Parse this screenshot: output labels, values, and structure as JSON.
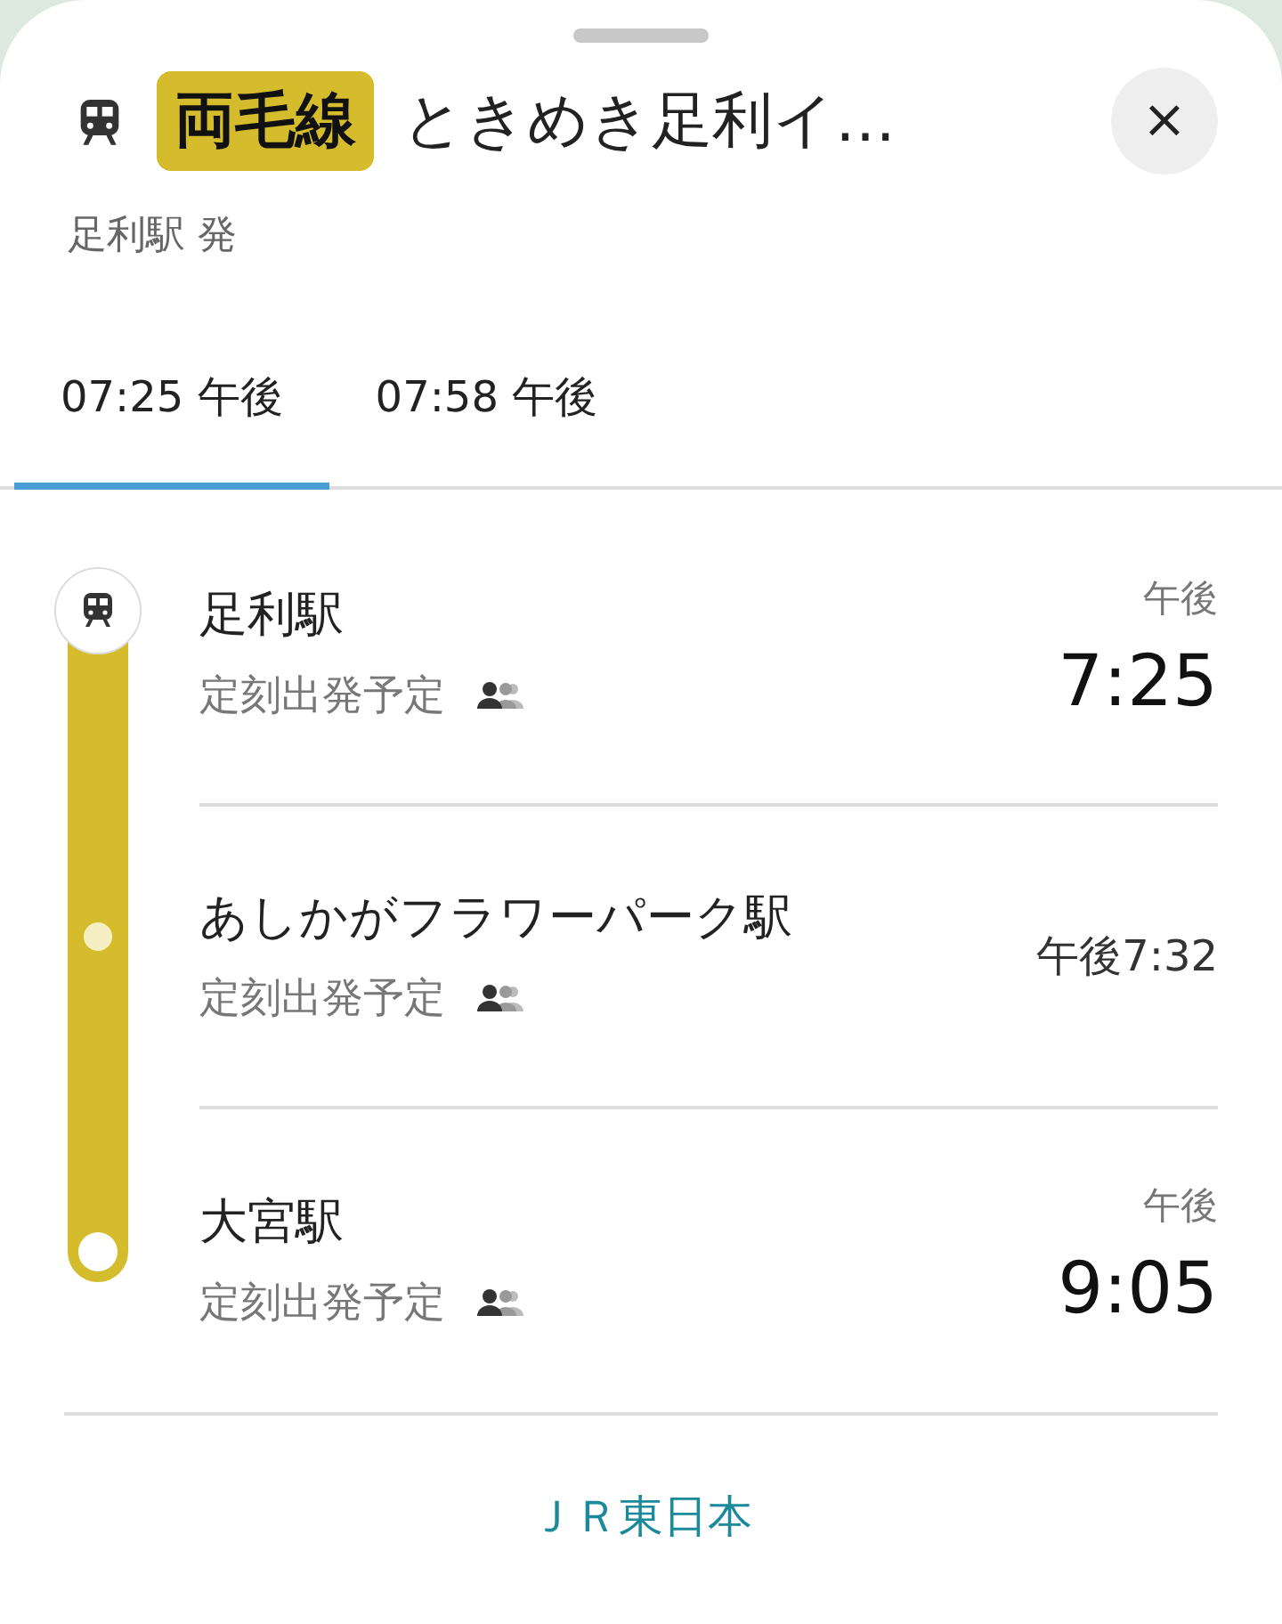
{
  "header": {
    "line": {
      "name": "両毛線",
      "color": "#d4bc2c"
    },
    "title": "ときめき足利イ…",
    "subtitle": "足利駅 発",
    "close": "×"
  },
  "tabs": [
    {
      "label": "07:25 午後",
      "selected": true
    },
    {
      "label": "07:58 午後",
      "selected": false
    }
  ],
  "stops": [
    {
      "kind": "origin",
      "name": "足利駅",
      "status": "定刻出発予定",
      "period": "午後",
      "time": "7:25"
    },
    {
      "kind": "intermediate",
      "name": "あしかがフラワーパーク駅",
      "status": "定刻出発予定",
      "time": "午後7:32"
    },
    {
      "kind": "terminal",
      "name": "大宮駅",
      "status": "定刻出発予定",
      "period": "午後",
      "time": "9:05"
    }
  ],
  "operator": "ＪＲ東日本"
}
